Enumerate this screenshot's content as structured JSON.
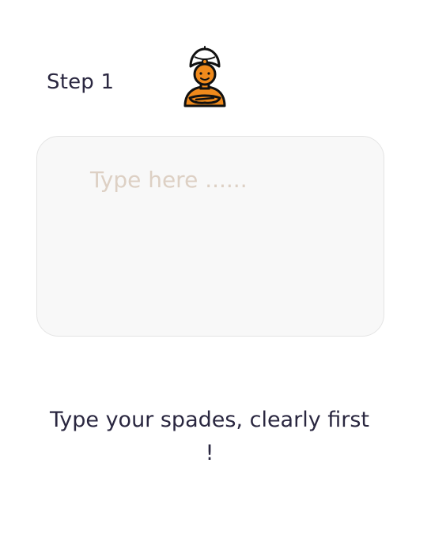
{
  "header": {
    "step_label": "Step 1",
    "mascot_icon": "genie-turban-icon"
  },
  "input": {
    "placeholder": "Type here ......",
    "value": ""
  },
  "instruction": {
    "text": "Type your spades, clearly first !"
  },
  "colors": {
    "text": "#2a2740",
    "placeholder": "#ddd0c4",
    "input_bg": "#f8f8f8",
    "input_border": "#e4e4e4",
    "mascot_skin": "#f08a1c",
    "mascot_outline": "#111111",
    "mascot_turban": "#ffffff"
  }
}
